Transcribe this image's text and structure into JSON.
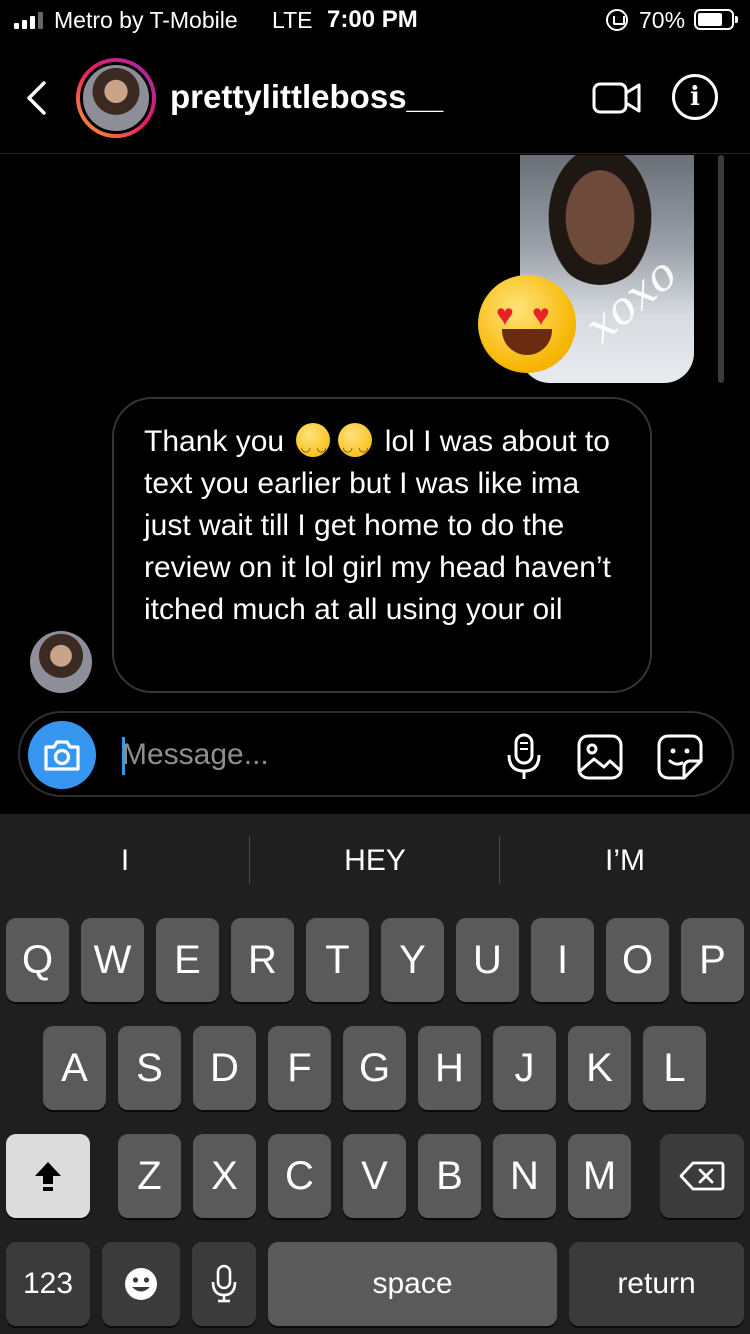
{
  "status_bar": {
    "carrier": "Metro by T-Mobile",
    "network": "LTE",
    "time": "7:00 PM",
    "battery": "70%"
  },
  "header": {
    "username": "prettylittleboss__",
    "back_icon": "chevron-left-icon",
    "video_icon": "video-call-icon",
    "info_icon": "info-icon",
    "info_glyph": "i"
  },
  "chat": {
    "photo_reaction": "heart-eyes-emoji",
    "photo_caption": "xoxo",
    "incoming_message": {
      "part1": "Thank you",
      "part2": "lol I was about to text you earlier but I was like ima just wait till I get home to do the review on it lol girl my head haven’t itched much at all using your oil"
    }
  },
  "composer": {
    "placeholder": "Message...",
    "camera_icon": "camera-icon",
    "mic_icon": "microphone-icon",
    "gallery_icon": "gallery-icon",
    "sticker_icon": "sticker-icon",
    "accent": "#3797f0"
  },
  "keyboard": {
    "suggestions": [
      "I",
      "HEY",
      "I’M"
    ],
    "row1": [
      "Q",
      "W",
      "E",
      "R",
      "T",
      "Y",
      "U",
      "I",
      "O",
      "P"
    ],
    "row2": [
      "A",
      "S",
      "D",
      "F",
      "G",
      "H",
      "J",
      "K",
      "L"
    ],
    "row3": [
      "Z",
      "X",
      "C",
      "V",
      "B",
      "N",
      "M"
    ],
    "numbers_label": "123",
    "space_label": "space",
    "return_label": "return"
  }
}
